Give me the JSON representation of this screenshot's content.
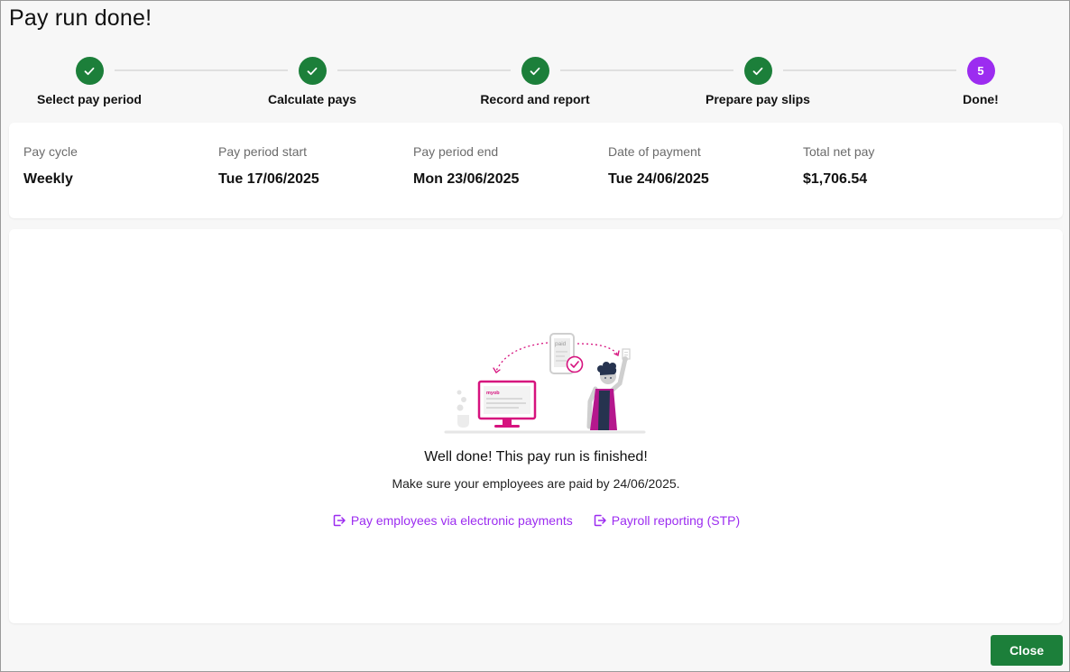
{
  "page": {
    "title": "Pay run done!"
  },
  "stepper": {
    "steps": [
      {
        "label": "Select pay period",
        "state": "done"
      },
      {
        "label": "Calculate pays",
        "state": "done"
      },
      {
        "label": "Record and report",
        "state": "done"
      },
      {
        "label": "Prepare pay slips",
        "state": "done"
      },
      {
        "label": "Done!",
        "state": "current",
        "number": "5"
      }
    ]
  },
  "summary": {
    "pay_cycle": {
      "label": "Pay cycle",
      "value": "Weekly"
    },
    "period_start": {
      "label": "Pay period start",
      "value": "Tue 17/06/2025"
    },
    "period_end": {
      "label": "Pay period end",
      "value": "Mon 23/06/2025"
    },
    "payment_date": {
      "label": "Date of payment",
      "value": "Tue 24/06/2025"
    },
    "total_net": {
      "label": "Total net pay",
      "value": "$1,706.54"
    }
  },
  "main": {
    "illustration": {
      "phone_text": "paid",
      "screen_brand": "myob"
    },
    "headline": "Well done! This pay run is finished!",
    "subline": "Make sure your employees are paid by 24/06/2025.",
    "links": {
      "electronic_payments": "Pay employees via electronic payments",
      "stp_reporting": "Payroll reporting (STP)"
    }
  },
  "footer": {
    "close_label": "Close"
  },
  "colors": {
    "success_green": "#1c7f3a",
    "accent_purple": "#9c2cf0",
    "illustration_magenta": "#d6127e"
  },
  "icons": {
    "done_step": "check-icon",
    "link": "export-icon"
  }
}
